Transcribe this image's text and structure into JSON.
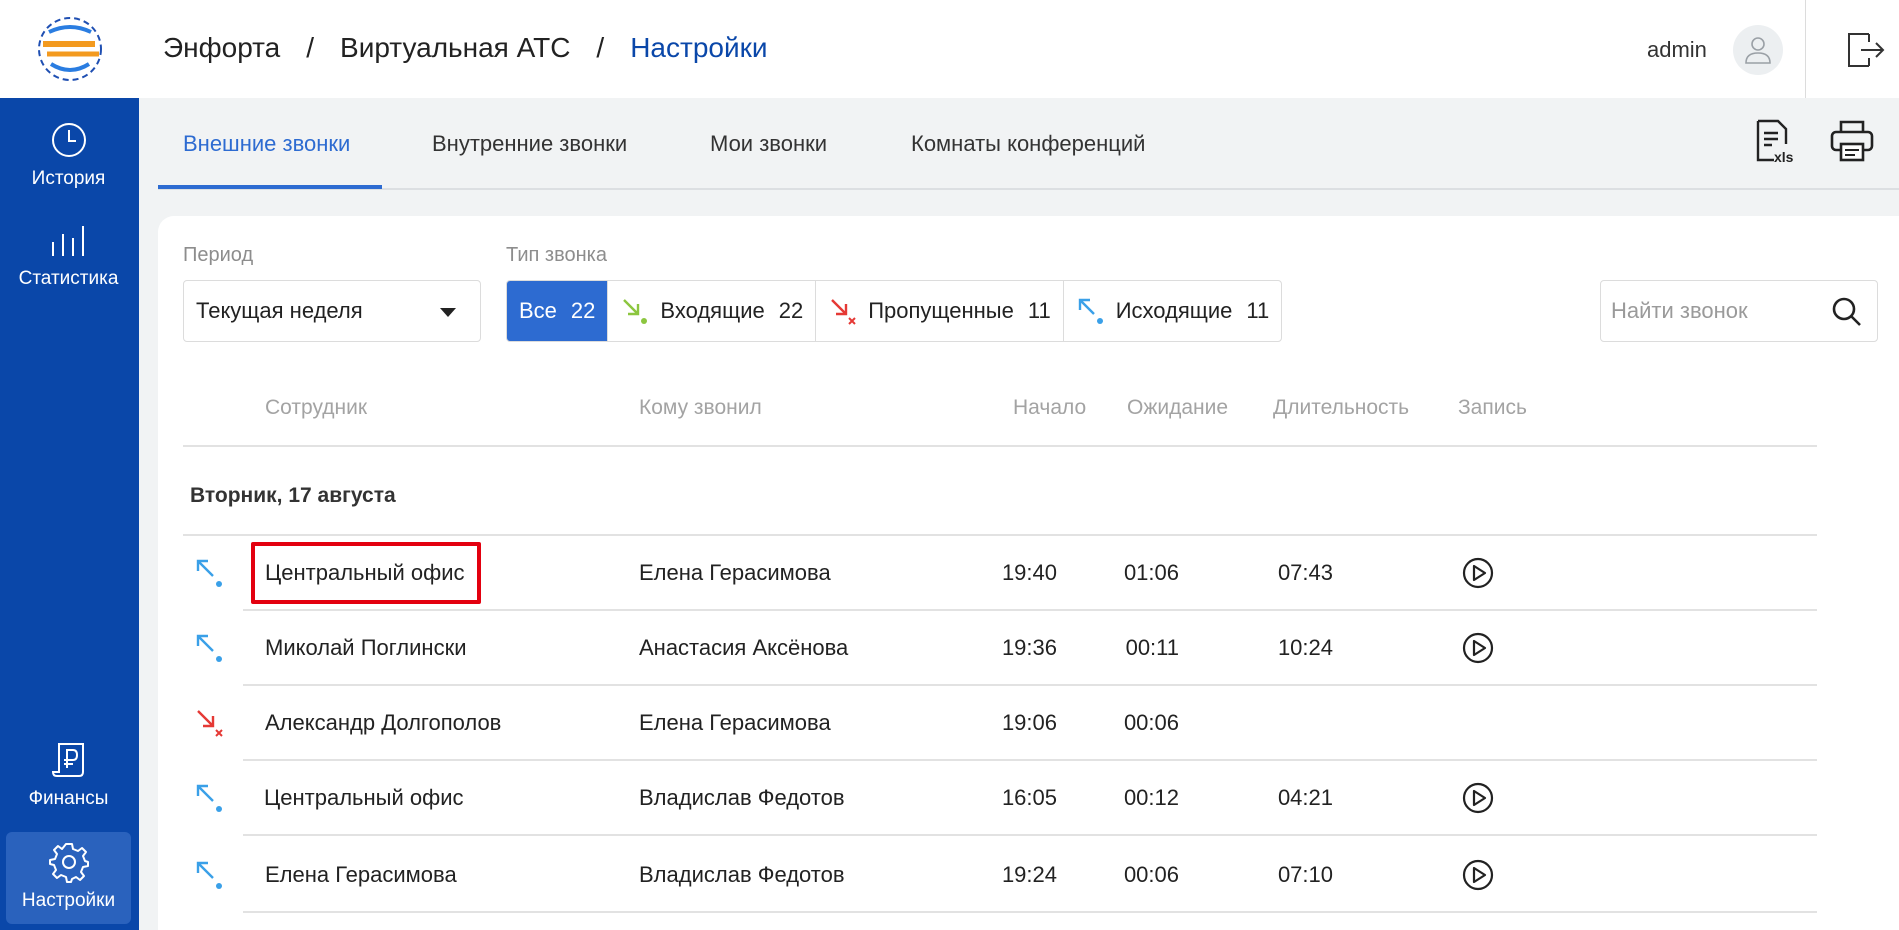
{
  "header": {
    "breadcrumb": [
      "Энфорта",
      "/",
      "Виртуальная АТС",
      "/",
      "Настройки"
    ],
    "user_name": "admin"
  },
  "sidebar": {
    "items": [
      {
        "label": "История",
        "icon": "clock-icon"
      },
      {
        "label": "Статистика",
        "icon": "bar-chart-icon"
      },
      {
        "label": "Финансы",
        "icon": "ruble-document-icon"
      },
      {
        "label": "Настройки",
        "icon": "gear-icon"
      }
    ],
    "active_item": "Настройки"
  },
  "tabs": [
    "Внешние звонки",
    "Внутренние звонки",
    "Мои звонки",
    "Комнаты конференций"
  ],
  "active_tab": "Внешние звонки",
  "toolbar_icons": [
    "xls-export-icon",
    "print-icon"
  ],
  "filters": {
    "period_label": "Период",
    "period_value": "Текущая неделя",
    "call_type_label": "Тип звонка",
    "types": [
      {
        "label": "Все",
        "count": "22",
        "active": true
      },
      {
        "label": "Входящие",
        "count": "22",
        "icon": "incoming-call-icon"
      },
      {
        "label": "Пропущенные",
        "count": "11",
        "icon": "missed-call-icon"
      },
      {
        "label": "Исходящие",
        "count": "11",
        "icon": "outgoing-call-icon"
      }
    ],
    "search_placeholder": "Найти звонок"
  },
  "table": {
    "columns": [
      "Сотрудник",
      "Кому звонил",
      "Начало",
      "Ожидание",
      "Длительность",
      "Запись"
    ],
    "day": "Вторник, 17 августа",
    "rows": [
      {
        "type": "outgoing",
        "employee": "Центральный офис",
        "callee": "Елена Герасимова",
        "start": "19:40",
        "wait": "01:06",
        "duration": "07:43",
        "record": true
      },
      {
        "type": "outgoing",
        "employee": "Миколай Поглински",
        "callee": "Анастасия Аксёнова",
        "start": "19:36",
        "wait": "00:11",
        "duration": "10:24",
        "record": true
      },
      {
        "type": "missed",
        "employee": "Александр Долгополов",
        "callee": "Елена Герасимова",
        "start": "19:06",
        "wait": "00:06",
        "duration": "",
        "record": false
      },
      {
        "type": "outgoing",
        "employee": "Центральный офис",
        "callee": "Владислав Федотов",
        "start": "16:05",
        "wait": "00:12",
        "duration": "04:21",
        "record": true
      },
      {
        "type": "outgoing",
        "employee": "Елена Герасимова",
        "callee": "Владислав Федотов",
        "start": "19:24",
        "wait": "00:06",
        "duration": "07:10",
        "record": true
      }
    ]
  },
  "colors": {
    "sidebar": "#0a47a9",
    "accent": "#2d6bd1",
    "incoming": "#8cc63f",
    "missed": "#e53935",
    "outgoing": "#3aa0e8",
    "highlight": "#e3000f"
  }
}
